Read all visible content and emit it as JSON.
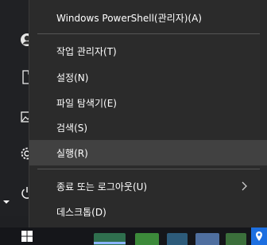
{
  "menu": {
    "items": [
      {
        "label": "Windows PowerShell(관리자)(A)"
      },
      {
        "label": "작업 관리자(T)"
      },
      {
        "label": "설정(N)"
      },
      {
        "label": "파일 탐색기(E)"
      },
      {
        "label": "검색(S)"
      },
      {
        "label": "실행(R)"
      },
      {
        "label": "종료 또는 로그아웃(U)"
      },
      {
        "label": "데스크톱(D)"
      }
    ],
    "hovered_item": "실행(R)",
    "submenu_indicator": "chevron-right-icon"
  },
  "rail": {
    "icons": [
      "user-avatar-icon",
      "document-icon",
      "pictures-icon",
      "settings-gear-icon",
      "power-icon"
    ]
  },
  "taskbar": {
    "start_icon": "windows-logo-icon",
    "tray_icon": "maps-pin-icon"
  },
  "colors": {
    "menu_background": "#2b2b2b",
    "menu_hover": "#414141",
    "text": "#ffffff",
    "separator": "#555555",
    "taskbar": "#15161a",
    "accent": "#1d6fe0"
  }
}
